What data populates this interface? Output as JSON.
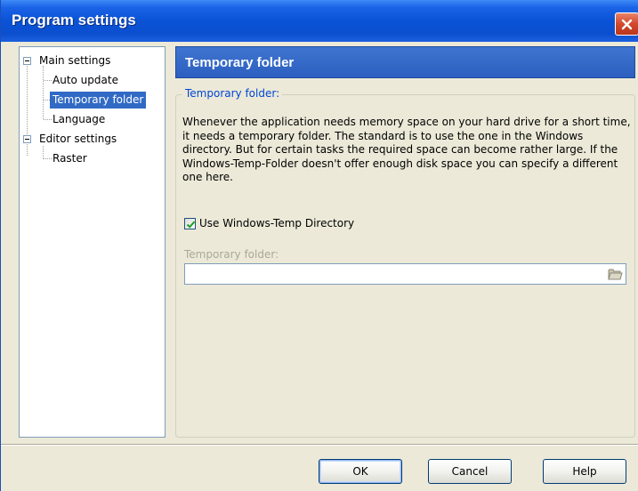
{
  "window": {
    "title": "Program settings"
  },
  "tree": {
    "items": [
      {
        "label": "Main settings"
      },
      {
        "label": "Auto update"
      },
      {
        "label": "Temporary folder",
        "selected": true
      },
      {
        "label": "Language"
      },
      {
        "label": "Editor settings"
      },
      {
        "label": "Raster"
      }
    ]
  },
  "panel": {
    "header": "Temporary folder",
    "group_label": "Temporary folder:",
    "description": "Whenever the application needs memory space on your hard drive for a short time, it needs a temporary folder. The standard is to use the one in the Windows directory. But for certain tasks the required space can become rather large. If the Windows-Temp-Folder doesn't offer enough disk space you can specify a different one here.",
    "checkbox_label": "Use Windows-Temp Directory",
    "checkbox_checked": true,
    "field_label": "Temporary folder:",
    "field_value": ""
  },
  "buttons": {
    "ok": "OK",
    "cancel": "Cancel",
    "help": "Help"
  },
  "colors": {
    "title_bar": "#0b4fcf",
    "header_bar": "#2c5fc0",
    "selection": "#316ac5",
    "group_label": "#0046d5",
    "dialog_bg": "#ece9d8"
  }
}
